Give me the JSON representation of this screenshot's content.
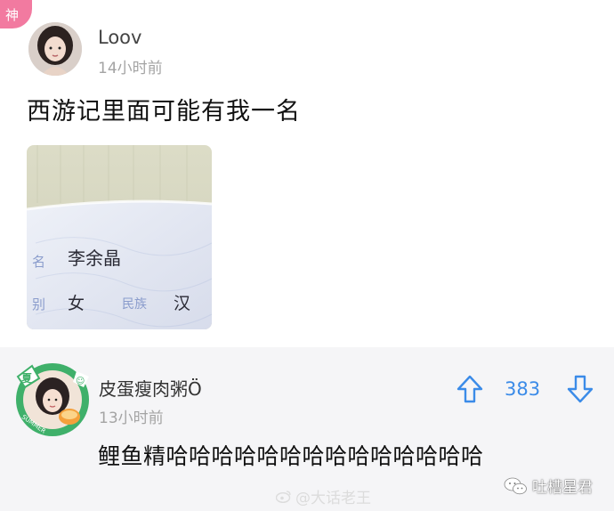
{
  "badge": {
    "label": "神"
  },
  "post": {
    "username": "Loov",
    "time": "14小时前",
    "text": "西游记里面可能有我一名",
    "photo": {
      "labels": {
        "name_key": "名",
        "name_value": "李余晶",
        "sex_key": "别",
        "sex_value": "女",
        "ethnic_key": "民族",
        "ethnic_value": "汉"
      }
    }
  },
  "comment": {
    "username": "皮蛋瘦肉粥Ö",
    "time": "13小时前",
    "votes": "383",
    "text": "鲤鱼精哈哈哈哈哈哈哈哈哈哈哈哈哈哈",
    "avatar_frame_text": "SUMMER"
  },
  "watermarks": {
    "weibo": "@大话老王",
    "wechat": "吐槽星君"
  },
  "colors": {
    "badge": "#f27aa0",
    "vote": "#3b8be8",
    "frame_green": "#3fb06a",
    "bottom_bg": "#f5f5f7"
  }
}
